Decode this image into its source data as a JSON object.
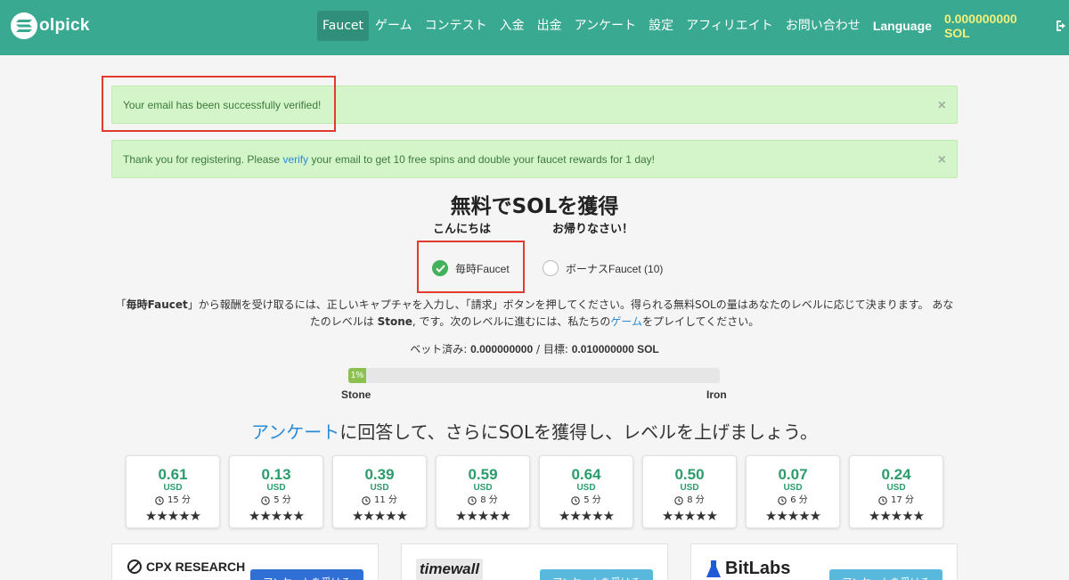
{
  "brand": {
    "name": "olpick"
  },
  "nav": {
    "items": [
      {
        "label": "Faucet",
        "active": true
      },
      {
        "label": "ゲーム"
      },
      {
        "label": "コンテスト"
      },
      {
        "label": "入金"
      },
      {
        "label": "出金"
      },
      {
        "label": "アンケート"
      },
      {
        "label": "設定"
      },
      {
        "label": "アフィリエイト"
      },
      {
        "label": "お問い合わせ"
      }
    ],
    "language": "Language",
    "balance": "0.000000000 SOL",
    "logout_icon": "sign-out-icon"
  },
  "alerts": [
    {
      "text": "Your email has been successfully verified!",
      "close": "×"
    },
    {
      "text_before": "Thank you for registering. Please ",
      "link": "verify",
      "text_after": " your email to get 10 free spins and double your faucet rewards for 1 day!",
      "close": "×"
    }
  ],
  "main": {
    "title": "無料でSOLを獲得",
    "greeting_before": "こんにちは",
    "greeting_after": "お帰りなさい！",
    "radios": [
      {
        "label": "毎時Faucet",
        "checked": true
      },
      {
        "label": "ボーナスFaucet (10)",
        "checked": false
      }
    ],
    "desc": {
      "open_quote": "「",
      "bold_name": "毎時Faucet",
      "part1": "」から報酬を受け取るには、正しいキャプチャを入力し、「請求」ボタンを押してください。得られる無料SOLの量はあなたのレベルに応じて決まります。 あなたのレベルは ",
      "level": "Stone",
      "part2": ", です。次のレベルに進むには、私たちの",
      "link": "ゲーム",
      "part3": "をプレイしてください。"
    },
    "wager": {
      "label1": "ベット済み: ",
      "value1": "0.000000000",
      "sep": " / 目標: ",
      "value2": "0.010000000 SOL"
    },
    "progress": {
      "percent": 1,
      "label": "1%",
      "from_level": "Stone",
      "to_level": "Iron"
    },
    "survey_heading": {
      "link": "アンケート",
      "rest": "に回答して、さらにSOLを獲得し、レベルを上げましょう。"
    }
  },
  "surveys": [
    {
      "amount": "0.61",
      "currency": "USD",
      "time": "15 分",
      "stars": "★★★★★"
    },
    {
      "amount": "0.13",
      "currency": "USD",
      "time": "5 分",
      "stars": "★★★★★"
    },
    {
      "amount": "0.39",
      "currency": "USD",
      "time": "11 分",
      "stars": "★★★★★"
    },
    {
      "amount": "0.59",
      "currency": "USD",
      "time": "8 分",
      "stars": "★★★★★"
    },
    {
      "amount": "0.64",
      "currency": "USD",
      "time": "5 分",
      "stars": "★★★★★"
    },
    {
      "amount": "0.50",
      "currency": "USD",
      "time": "8 分",
      "stars": "★★★★★"
    },
    {
      "amount": "0.07",
      "currency": "USD",
      "time": "6 分",
      "stars": "★★★★★"
    },
    {
      "amount": "0.24",
      "currency": "USD",
      "time": "17 分",
      "stars": "★★★★★"
    }
  ],
  "providers": [
    {
      "name": "CPX RESEARCH",
      "button": "アンケートを受ける",
      "button_color": "#2f6fd6"
    },
    {
      "name": "timewall",
      "button": "アンケートを受ける",
      "button_color": "#58b9dc"
    },
    {
      "name": "BitLabs",
      "button": "アンケートを受ける",
      "button_color": "#58b9dc"
    }
  ],
  "colors": {
    "navbar": "#3aa991",
    "balance": "#f3f07a",
    "alert_bg": "#d4f5c9",
    "link": "#2a8bd6",
    "amount": "#2a9c6b",
    "progress": "#8cc152",
    "highlight": "#e03b2e"
  }
}
